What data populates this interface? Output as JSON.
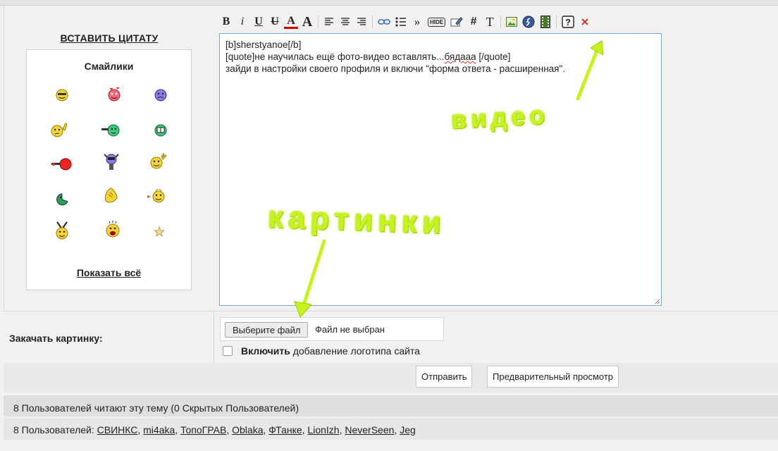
{
  "left_panel": {
    "quote_link": "ВСТАВИТЬ ЦИТАТУ",
    "smilies_title": "Смайлики",
    "show_all_link": "Показать всё"
  },
  "toolbar": {
    "buttons": [
      {
        "name": "bold-button",
        "label": "B"
      },
      {
        "name": "italic-button",
        "label": "i"
      },
      {
        "name": "underline-button",
        "label": "U"
      },
      {
        "name": "strike-button",
        "label": "U"
      },
      {
        "name": "font-color-button",
        "label": "A"
      },
      {
        "name": "font-size-button",
        "label": "A"
      },
      {
        "name": "hash-button",
        "label": "#"
      },
      {
        "name": "text-button",
        "label": "T"
      },
      {
        "name": "quote-button",
        "label": "»"
      },
      {
        "name": "hide-button",
        "label": "HIDE"
      }
    ]
  },
  "editor": {
    "lines": [
      "[b]sherstyanoe[/b]",
      "[quote]не научилась ещё фото-видео вставлять...бядааа [/quote]",
      "зайди в настройки своего профиля и включи \"форма ответа - расширенная\"."
    ],
    "squiggle_word": "бядааа"
  },
  "upload": {
    "label": "Закачать картинку:",
    "file_button": "Выберите файл",
    "file_status": "Файл не выбран",
    "logo_bold": "Включить",
    "logo_rest": "добавление логотипа сайта"
  },
  "actions": {
    "submit": "Отправить",
    "preview": "Предварительный просмотр"
  },
  "users": {
    "reading_text": "8 Пользователей читают эту тему (0 Скрытых Пользователей)",
    "list_prefix": "8 Пользователей:",
    "names": [
      "СВИНКС",
      "mi4aka",
      "ТопоГРАВ",
      "Oblaka",
      "ФТанке",
      "LionIzh",
      "NeverSeen",
      "Jeg"
    ]
  },
  "annotations": {
    "video": "видео",
    "pictures": "картинки"
  },
  "colors": {
    "annotation_green": "#c8f21e",
    "editor_border": "#7ea6d9"
  }
}
